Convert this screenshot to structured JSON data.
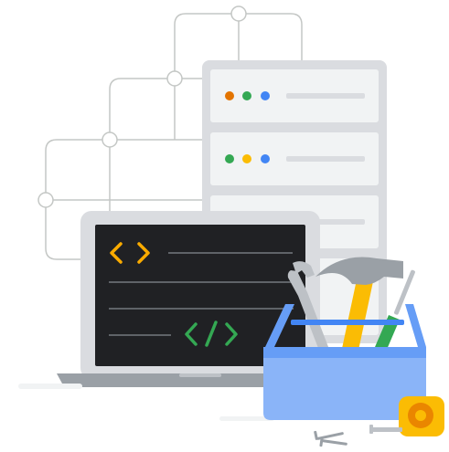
{
  "illustration": {
    "palette": {
      "line": "#c4c7c5",
      "server_frame": "#dadce0",
      "server_panel": "#f1f3f4",
      "server_bar": "#dadce0",
      "laptop_body": "#dadce0",
      "laptop_base": "#9aa0a6",
      "screen": "#202124",
      "screen_line": "#5f6368",
      "code_yellow": "#f9ab00",
      "code_green": "#34a853",
      "dot_orange": "#e37400",
      "dot_green": "#34a853",
      "dot_blue": "#4285f4",
      "dot_yellow": "#fbbc04",
      "toolbox": "#8ab4f8",
      "toolbox_dark": "#669df6",
      "toolbox_handle": "#4285f4",
      "hammer_head": "#9aa0a6",
      "hammer_handle": "#fbbc04",
      "wrench": "#bdc1c6",
      "screwdriver_green": "#34a853",
      "tape": "#fbbc04",
      "tape_dark": "#ea8600"
    },
    "icons": [
      "network-diagram-icon",
      "server-rack-icon",
      "laptop-icon",
      "code-brackets-icon",
      "closing-tag-icon",
      "toolbox-icon",
      "hammer-icon",
      "wrench-icon",
      "screwdriver-icon",
      "tape-measure-icon",
      "nail-icon"
    ]
  }
}
